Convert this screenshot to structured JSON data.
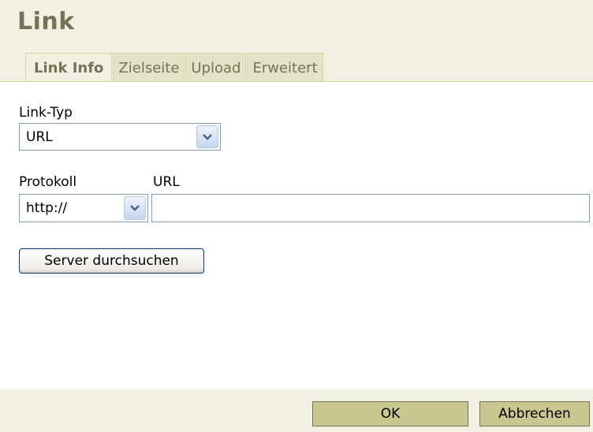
{
  "dialog": {
    "title": "Link"
  },
  "tabs": [
    {
      "label": "Link Info",
      "active": true
    },
    {
      "label": "Zielseite",
      "active": false
    },
    {
      "label": "Upload",
      "active": false
    },
    {
      "label": "Erweitert",
      "active": false
    }
  ],
  "form": {
    "link_type_label": "Link-Typ",
    "link_type_value": "URL",
    "protocol_label": "Protokoll",
    "protocol_value": "http://",
    "url_label": "URL",
    "url_value": "",
    "browse_button": "Server durchsuchen"
  },
  "footer": {
    "ok": "OK",
    "cancel": "Abbrechen"
  },
  "icons": {
    "dropdown": "chevron-down-icon"
  },
  "colors": {
    "header_bg": "#f1f1e3",
    "title": "#737357",
    "tab_bg": "#e3e3c7",
    "button_bg": "#c7c78f",
    "field_border": "#7f9db9"
  }
}
